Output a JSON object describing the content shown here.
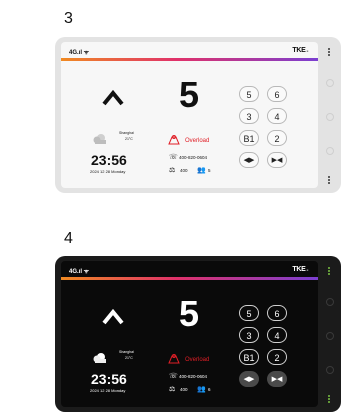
{
  "variants": [
    {
      "label": "3",
      "theme": "light",
      "status_text": "4G",
      "brand": "TKE",
      "direction": "up",
      "floor": "5",
      "city": "Shanghai",
      "temperature": "21°C",
      "time": "23:56",
      "date": "2024 12 28 Monday",
      "alert": "Overload",
      "phone": "400-820-0604",
      "capacity_kg": "400",
      "capacity_persons": "5",
      "buttons": [
        "5",
        "6",
        "3",
        "4",
        "B1",
        "2"
      ],
      "door_open_icon": "door-open-icon",
      "door_close_icon": "door-close-icon"
    },
    {
      "label": "4",
      "theme": "dark",
      "status_text": "4G",
      "brand": "TKE",
      "direction": "up",
      "floor": "5",
      "city": "Shanghai",
      "temperature": "21°C",
      "time": "23:56",
      "date": "2024 12 28 Monday",
      "alert": "Overload",
      "phone": "400-820-0604",
      "capacity_kg": "400",
      "capacity_persons": "6",
      "buttons": [
        "5",
        "6",
        "3",
        "4",
        "B1",
        "2"
      ],
      "door_open_icon": "door-open-icon",
      "door_close_icon": "door-close-icon"
    }
  ],
  "colors": {
    "alert": "#e01e26",
    "gradient_start": "#f08a22",
    "gradient_mid": "#e0316a",
    "gradient_end": "#7b3fd1",
    "light_bg": "#f7f7f7",
    "dark_bg": "#0a0a0a"
  }
}
